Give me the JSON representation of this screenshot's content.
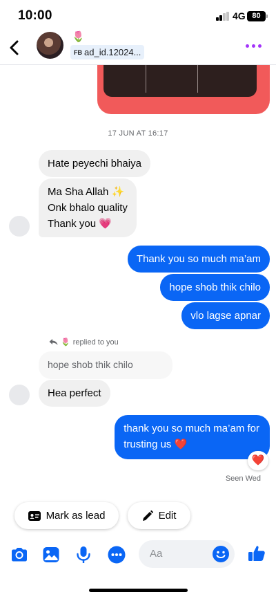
{
  "status_bar": {
    "time": "10:00",
    "network": "4G",
    "battery": "80"
  },
  "header": {
    "contact_emoji": "🌷",
    "contact_badge": "FB",
    "contact_id": "ad_id.12024..."
  },
  "timestamp": "17 JUN AT 16:17",
  "messages": [
    {
      "from": "them",
      "text": "Hate peyechi bhaiya"
    },
    {
      "from": "them",
      "lines": [
        "Ma Sha Allah ✨",
        "Onk bhalo quality",
        "Thank you 💗"
      ]
    },
    {
      "from": "me",
      "text": "Thank you so much ma’am"
    },
    {
      "from": "me",
      "text": "hope shob thik chilo"
    },
    {
      "from": "me",
      "text": "vlo lagse apnar"
    },
    {
      "from": "them",
      "reply_label": "replied to you",
      "reply_emoji": "🌷",
      "quoted": "hope shob thik chilo",
      "text": "Hea perfect"
    },
    {
      "from": "me",
      "lines": [
        "thank you so much ma’am for",
        "trusting us ❤️"
      ],
      "reaction": "❤️"
    }
  ],
  "seen": "Seen Wed",
  "actions": {
    "mark_lead": "Mark as lead",
    "edit": "Edit"
  },
  "composer": {
    "placeholder": "Aa"
  },
  "colors": {
    "accent": "#0a66f5",
    "more_dots": "#a334fa",
    "image_card": "#f15a5a",
    "incoming_bubble": "#f0f0f0"
  },
  "icons": [
    "back-icon",
    "more-icon",
    "reply-icon",
    "id-card-icon",
    "pencil-icon",
    "camera-icon",
    "gallery-icon",
    "microphone-icon",
    "apps-icon",
    "emoji-icon",
    "like-icon"
  ]
}
